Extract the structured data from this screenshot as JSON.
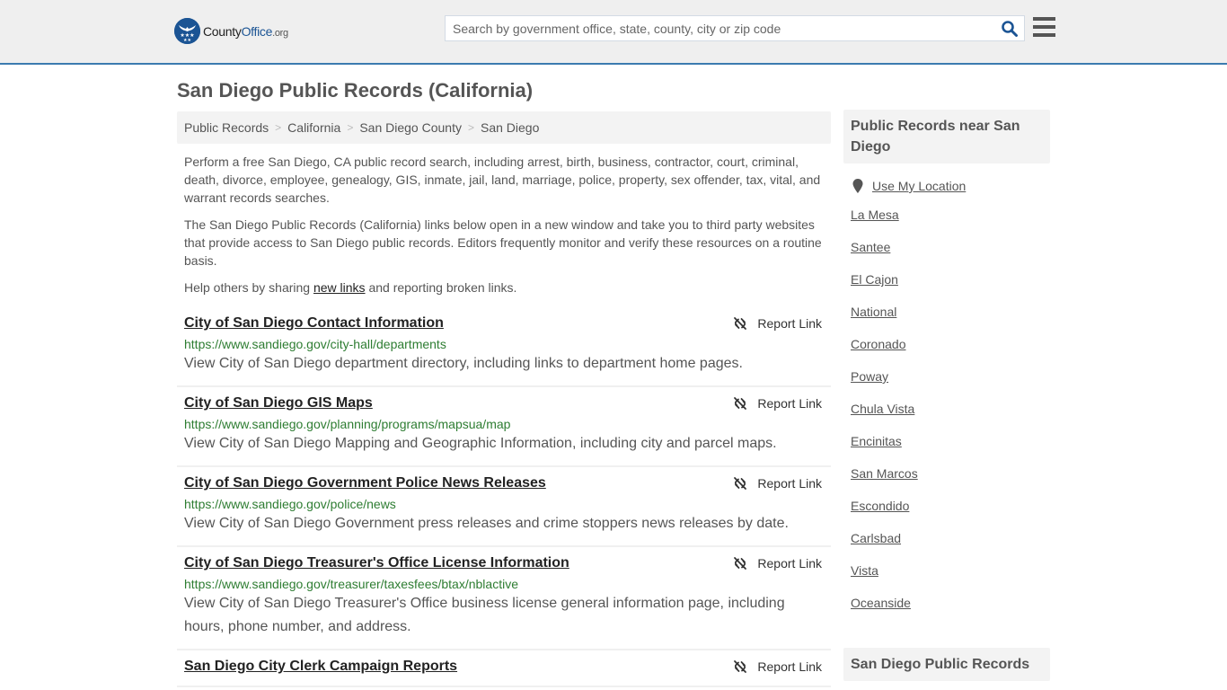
{
  "header": {
    "logo": {
      "name": "County",
      "office": "Office",
      "tld": ".org"
    },
    "search": {
      "placeholder": "Search by government office, state, county, city or zip code",
      "value": ""
    },
    "colors": {
      "brand": "#1b5494",
      "header_bg": "#efefef",
      "header_border": "#3b7bb0"
    }
  },
  "page": {
    "title": "San Diego Public Records (California)"
  },
  "breadcrumb": [
    {
      "label": "Public Records"
    },
    {
      "label": "California"
    },
    {
      "label": "San Diego County"
    },
    {
      "label": "San Diego"
    }
  ],
  "breadcrumb_separator": ">",
  "intro": {
    "p1": "Perform a free San Diego, CA public record search, including arrest, birth, business, contractor, court, criminal, death, divorce, employee, genealogy, GIS, inmate, jail, land, marriage, police, property, sex offender, tax, vital, and warrant records searches.",
    "p2": "The San Diego Public Records (California) links below open in a new window and take you to third party websites that provide access to San Diego public records. Editors frequently monitor and verify these resources on a routine basis.",
    "p3_before": "Help others by sharing ",
    "p3_link": "new links",
    "p3_after": " and reporting broken links."
  },
  "results": [
    {
      "title": "City of San Diego Contact Information",
      "url": "https://www.sandiego.gov/city-hall/departments",
      "description": "View City of San Diego department directory, including links to department home pages.",
      "report_label": "Report Link"
    },
    {
      "title": "City of San Diego GIS Maps",
      "url": "https://www.sandiego.gov/planning/programs/mapsua/map",
      "description": "View City of San Diego Mapping and Geographic Information, including city and parcel maps.",
      "report_label": "Report Link"
    },
    {
      "title": "City of San Diego Government Police News Releases",
      "url": "https://www.sandiego.gov/police/news",
      "description": "View City of San Diego Government press releases and crime stoppers news releases by date.",
      "report_label": "Report Link"
    },
    {
      "title": "City of San Diego Treasurer's Office License Information",
      "url": "https://www.sandiego.gov/treasurer/taxesfees/btax/nblactive",
      "description": "View City of San Diego Treasurer's Office business license general information page, including hours, phone number, and address.",
      "report_label": "Report Link"
    },
    {
      "title": "San Diego City Clerk Campaign Reports",
      "url": "",
      "description": "",
      "report_label": "Report Link"
    }
  ],
  "sidebar": {
    "nearby_heading": "Public Records near San Diego",
    "use_location": "Use My Location",
    "cities": [
      "La Mesa",
      "Santee",
      "El Cajon",
      "National",
      "Coronado",
      "Poway",
      "Chula Vista",
      "Encinitas",
      "San Marcos",
      "Escondido",
      "Carlsbad",
      "Vista",
      "Oceanside"
    ],
    "second_heading": "San Diego Public Records"
  }
}
